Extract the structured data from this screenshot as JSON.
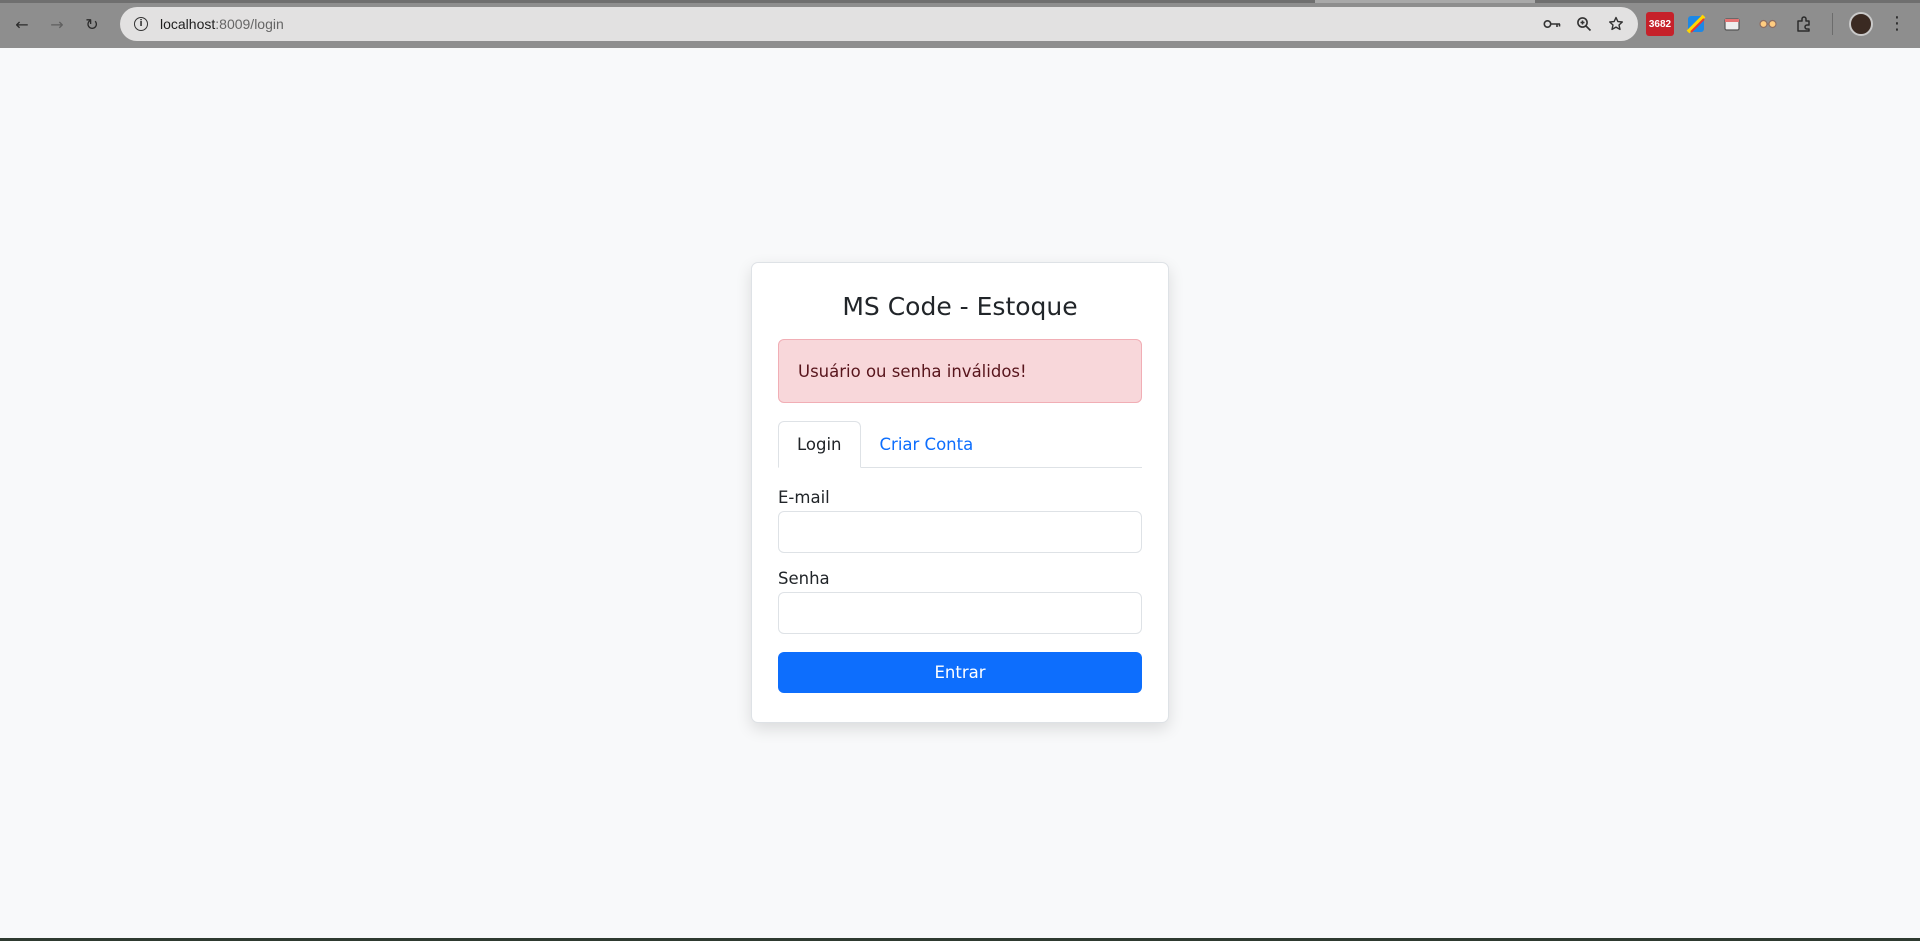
{
  "browser": {
    "url_host": "localhost",
    "url_path": ":8009/login",
    "extension_badge": "3682"
  },
  "card": {
    "title": "MS Code - Estoque",
    "alert": "Usuário ou senha inválidos!",
    "tabs": [
      {
        "label": "Login",
        "active": true
      },
      {
        "label": "Criar Conta",
        "active": false
      }
    ],
    "email_label": "E-mail",
    "email_value": "",
    "password_label": "Senha",
    "password_value": "",
    "submit_label": "Entrar"
  },
  "colors": {
    "primary": "#0d6efd",
    "alert_bg": "#f8d7da",
    "alert_text": "#58151c"
  }
}
